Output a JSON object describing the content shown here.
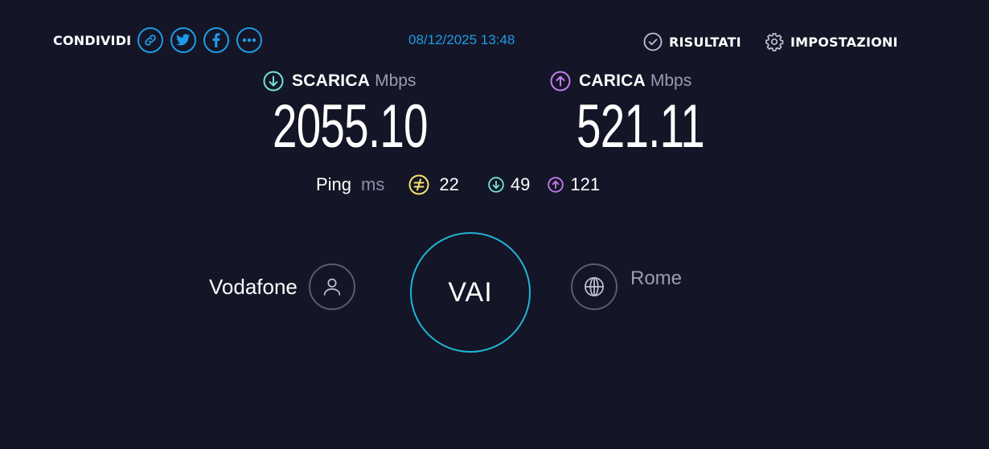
{
  "header": {
    "share_label": "CONDIVIDI",
    "share_buttons": [
      "link-icon",
      "twitter-icon",
      "facebook-icon",
      "more-icon"
    ],
    "timestamp": "08/12/2025 13:48",
    "results_label": "RISULTATI",
    "settings_label": "IMPOSTAZIONI"
  },
  "download": {
    "label": "SCARICA",
    "unit": "Mbps",
    "value": "2055.10",
    "icon": "arrow-down-circle-icon",
    "color": "#6fe3d6"
  },
  "upload": {
    "label": "CARICA",
    "unit": "Mbps",
    "value": "521.11",
    "icon": "arrow-up-circle-icon",
    "color": "#c27cf0"
  },
  "ping": {
    "label": "Ping",
    "unit": "ms",
    "idle": "22",
    "download": "49",
    "upload": "121",
    "idle_color": "#f5e36b"
  },
  "connection": {
    "provider": "Vodafone",
    "go_label": "VAI",
    "server": "Rome"
  },
  "colors": {
    "accent": "#1e9be6",
    "background": "#141526",
    "go_ring": "#1fb5d6"
  }
}
